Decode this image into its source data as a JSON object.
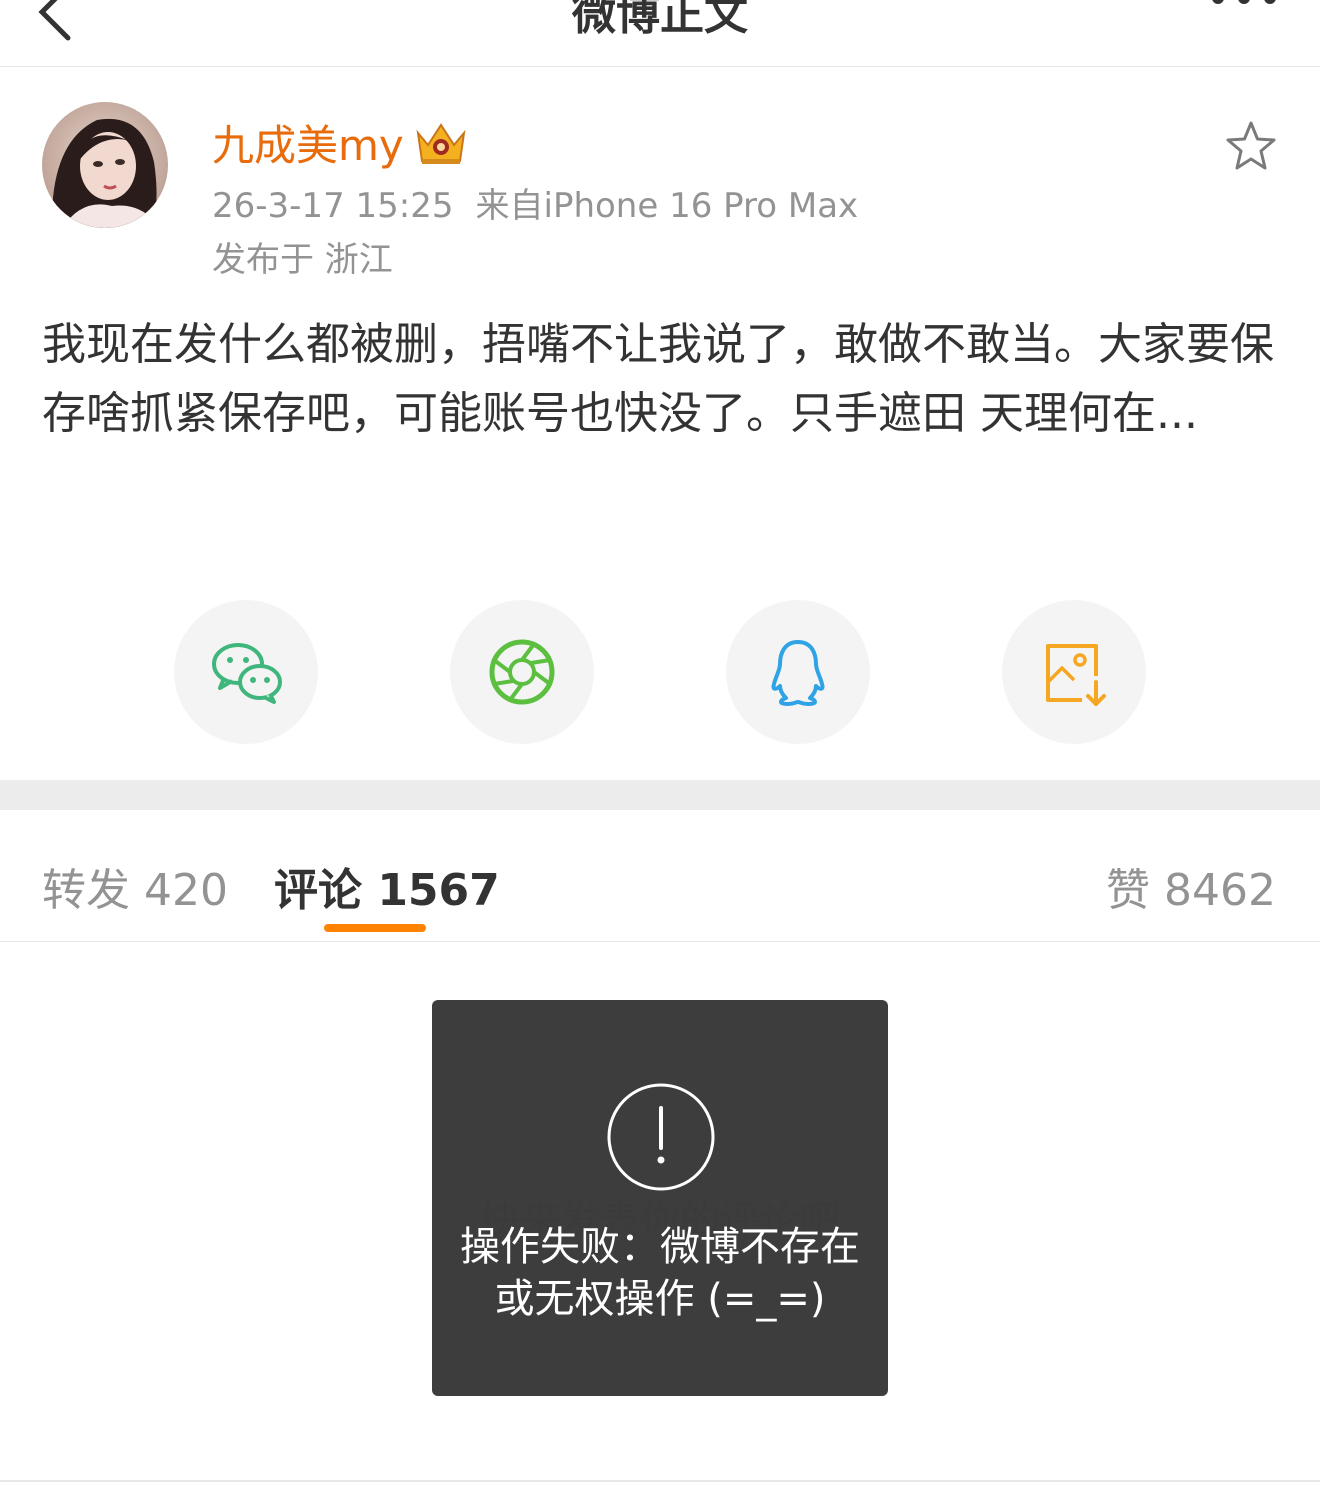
{
  "navbar": {
    "title": "微博正文"
  },
  "post": {
    "username": "九成美my",
    "timestamp": "26-3-17 15:25",
    "source": "来自iPhone 16 Pro Max",
    "location": "发布于 浙江",
    "text": "我现在发什么都被删，捂嘴不让我说了，敢做不敢当。大家要保存啥抓紧保存吧，可能账号也快没了。只手遮田 天理何在..."
  },
  "share": {
    "items": [
      {
        "icon": "wechat-icon",
        "color": "#3fb67b"
      },
      {
        "icon": "moments-icon",
        "color": "#5cbf3f"
      },
      {
        "icon": "qq-icon",
        "color": "#2fa3e6"
      },
      {
        "icon": "save-image-icon",
        "color": "#f5a623"
      }
    ]
  },
  "tabs": {
    "repost": "转发 420",
    "comments": "评论 1567",
    "likes": "赞 8462",
    "accent": "#ff8200"
  },
  "comments": {
    "empty_hint": "快来发表你的评论吧"
  },
  "toast": {
    "message": "操作失败：微博不存在或无权操作 (=_=)"
  },
  "colors": {
    "username": "#e86b0c",
    "meta": "#939393"
  }
}
